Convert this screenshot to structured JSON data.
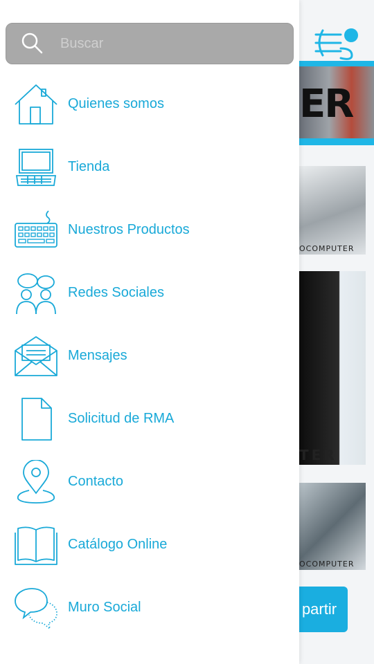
{
  "search": {
    "placeholder": "Buscar"
  },
  "menu": {
    "items": [
      {
        "label": "Quienes somos",
        "icon": "house-icon"
      },
      {
        "label": "Tienda",
        "icon": "laptop-icon"
      },
      {
        "label": "Nuestros Productos",
        "icon": "keyboard-icon"
      },
      {
        "label": "Redes Sociales",
        "icon": "people-chat-icon"
      },
      {
        "label": "Mensajes",
        "icon": "envelope-icon"
      },
      {
        "label": "Solicitud de RMA",
        "icon": "document-icon"
      },
      {
        "label": "Contacto",
        "icon": "map-pin-icon"
      },
      {
        "label": "Catálogo Online",
        "icon": "open-book-icon"
      },
      {
        "label": "Muro Social",
        "icon": "chat-bubbles-icon"
      }
    ]
  },
  "background": {
    "banner_text": "ER",
    "card_caption": "OCOMPUTER",
    "card_caption_2": "TER",
    "share_button_label": "partir"
  },
  "colors": {
    "accent": "#19a9d8",
    "search_bg": "#a9a9a9",
    "drawer_bg": "#ffffff"
  }
}
